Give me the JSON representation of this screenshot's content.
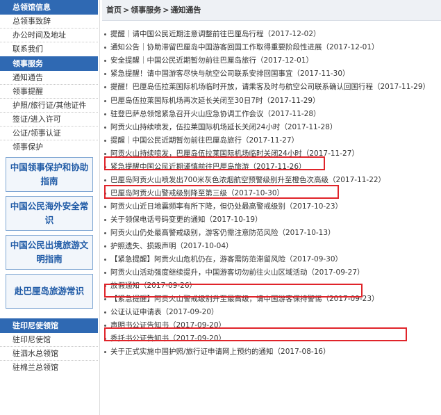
{
  "sidebar": {
    "section1_title": "总领馆信息",
    "section1_items": [
      "总领事致辞",
      "办公时间及地址",
      "联系我们"
    ],
    "section2_title": "领事服务",
    "section2_items": [
      "通知通告",
      "领事提醒",
      "护照/旅行证/其他证件",
      "签证/进入许可",
      "公证/领事认证",
      "领事保护"
    ],
    "promos": [
      "中国领事保护和协助指南",
      "中国公民海外安全常识",
      "中国公民出境旅游文明指南",
      "赴巴厘岛旅游常识"
    ],
    "section3_title": "驻印尼使领馆",
    "section3_items": [
      "驻印尼使馆",
      "驻泗水总领馆",
      "驻棉兰总领馆"
    ]
  },
  "breadcrumb": {
    "home": "首页",
    "level1": "领事服务",
    "level2": "通知通告",
    "separator": ">"
  },
  "notices": [
    "提醒｜请中国公民近期注意调整前往巴厘岛行程（2017-12-02）",
    "通知公告｜协助滞留巴厘岛中国游客回国工作取得重要阶段性进展（2017-12-01）",
    "安全提醒｜中国公民近期暂勿前往巴厘岛旅行（2017-12-01）",
    "紧急提醒！请中国游客尽快与航空公司联系安排回国事宜（2017-11-30）",
    "提醒！巴厘岛伍拉莱国际机场临时开放，请乘客及时与航空公司联系确认回国行程（2017-11-29）",
    "巴厘岛伍拉莱国际机场再次延长关闭至30日7时（2017-11-29）",
    "驻登巴萨总领馆紧急召开火山应急协调工作会议（2017-11-28）",
    "阿贡火山持续喷发，伍拉莱国际机场延长关闭24小时（2017-11-28）",
    "提醒｜中国公民近期暂勿前往巴厘岛旅行（2017-11-27）",
    "阿贡火山持续喷发，巴厘岛伍拉莱国际机场临时关闭24小时（2017-11-27）",
    "紧急提醒中国公民近期谨慎前往巴厘岛旅游（2017-11-26）",
    "巴厘岛阿贡火山喷发出700米灰色浓烟航空预警级别升至橙色次高级（2017-11-22）",
    "巴厘岛阿贡火山警戒级别降至第三级（2017-10-30）",
    "阿贡火山近日地震频率有所下降，但仍处最高警戒级别（2017-10-23）",
    "关于领保电话号码变更的通知（2017-10-19）",
    "阿贡火山仍处最高警戒级别，游客仍需注意防范风险（2017-10-13）",
    "护照遗失、损毁声明（2017-10-04）",
    "【紧急提醒】阿贡火山危机仍在，游客需防范滞留风险（2017-09-30）",
    "阿贡火山活动强度继续提升，中国游客切勿前往火山区域活动（2017-09-27）",
    "放假通知（2017-09-26）",
    "【紧急提醒】阿贡火山警戒级别升至最高级，请中国游客保持警惕（2017-09-23）",
    "公证认证申请表（2017-09-20）",
    "声明书公证告知书（2017-09-20）",
    "委托书公证告知书（2017-09-20）",
    "关于正式实施中国护照/旅行证申请网上预约的通知（2017-08-16）"
  ],
  "colors": {
    "accent": "#2f69b3",
    "highlight": "#e0242a",
    "promo_text": "#1f5aa6"
  }
}
